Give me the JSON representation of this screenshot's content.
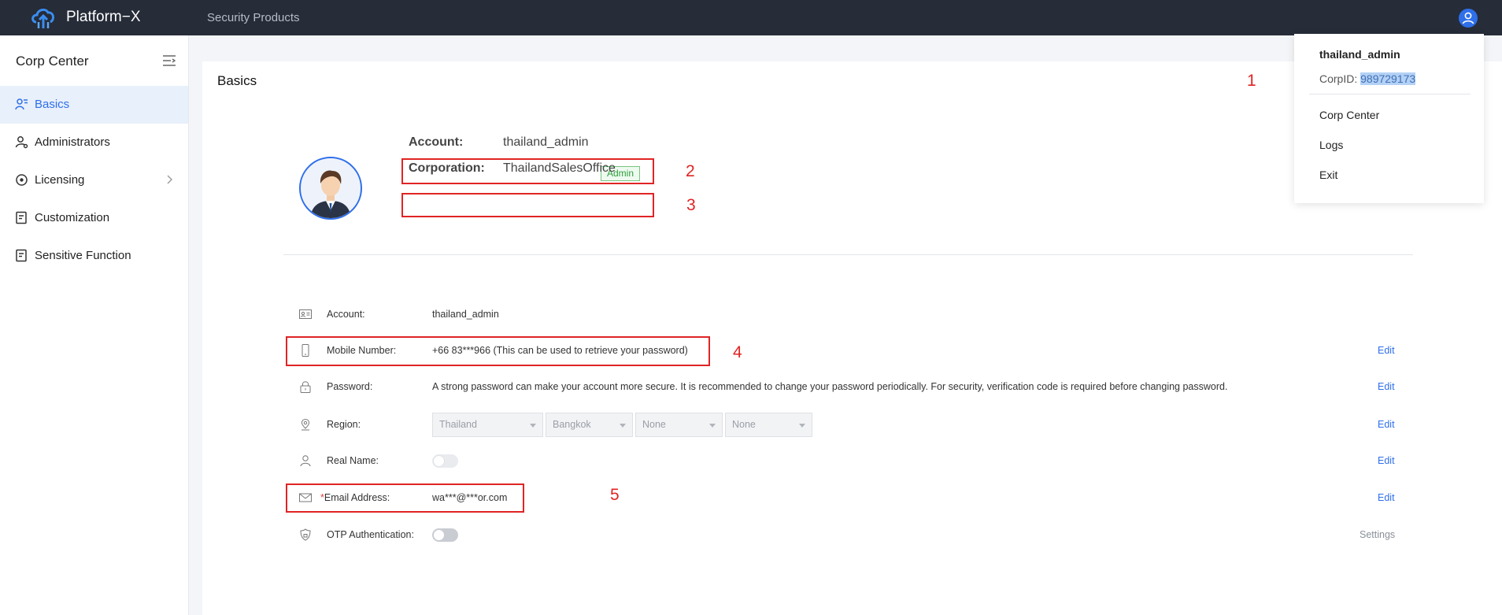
{
  "topbar": {
    "brand": "Platform−X",
    "nav_item": "Security Products"
  },
  "sidebar": {
    "title": "Corp Center",
    "items": [
      {
        "label": "Basics",
        "icon": "user-group-icon",
        "active": true
      },
      {
        "label": "Administrators",
        "icon": "admin-icon"
      },
      {
        "label": "Licensing",
        "icon": "license-icon",
        "has_submenu": true
      },
      {
        "label": "Customization",
        "icon": "customize-icon"
      },
      {
        "label": "Sensitive Function",
        "icon": "sensitive-function-icon"
      }
    ]
  },
  "main": {
    "title": "Basics",
    "header": {
      "account_label": "Account:",
      "account_value": "thailand_admin",
      "badge": "Admin",
      "corporation_label": "Corporation:",
      "corporation_value": "ThailandSalesOffice"
    },
    "fields": {
      "account": {
        "label": "Account:",
        "value": "thailand_admin"
      },
      "mobile": {
        "label": "Mobile Number:",
        "value": "+66 83***966 (This can be used to retrieve your password)",
        "action": "Edit"
      },
      "password": {
        "label": "Password:",
        "value": "A strong password can make your account more secure. It is recommended to change your password periodically. For security, verification code is required before changing password.",
        "action": "Edit"
      },
      "region": {
        "label": "Region:",
        "selects": [
          "Thailand",
          "Bangkok",
          "None",
          "None"
        ],
        "action": "Edit"
      },
      "real_name": {
        "label": "Real Name:",
        "action": "Edit"
      },
      "email": {
        "required_mark": "*",
        "label": "Email Address:",
        "value": "wa***@***or.com",
        "action": "Edit"
      },
      "otp": {
        "label": "OTP Authentication:",
        "action": "Settings"
      }
    }
  },
  "dropdown": {
    "username": "thailand_admin",
    "corp_label": "CorpID: ",
    "corp_id": "989729173",
    "items": [
      "Corp Center",
      "Logs",
      "Exit"
    ]
  },
  "annotations": [
    "1",
    "2",
    "3",
    "4",
    "5"
  ],
  "colors": {
    "accent": "#2f6fea",
    "topbar": "#262c38",
    "annotation": "#e02424",
    "badge": "#2e9d3a"
  }
}
